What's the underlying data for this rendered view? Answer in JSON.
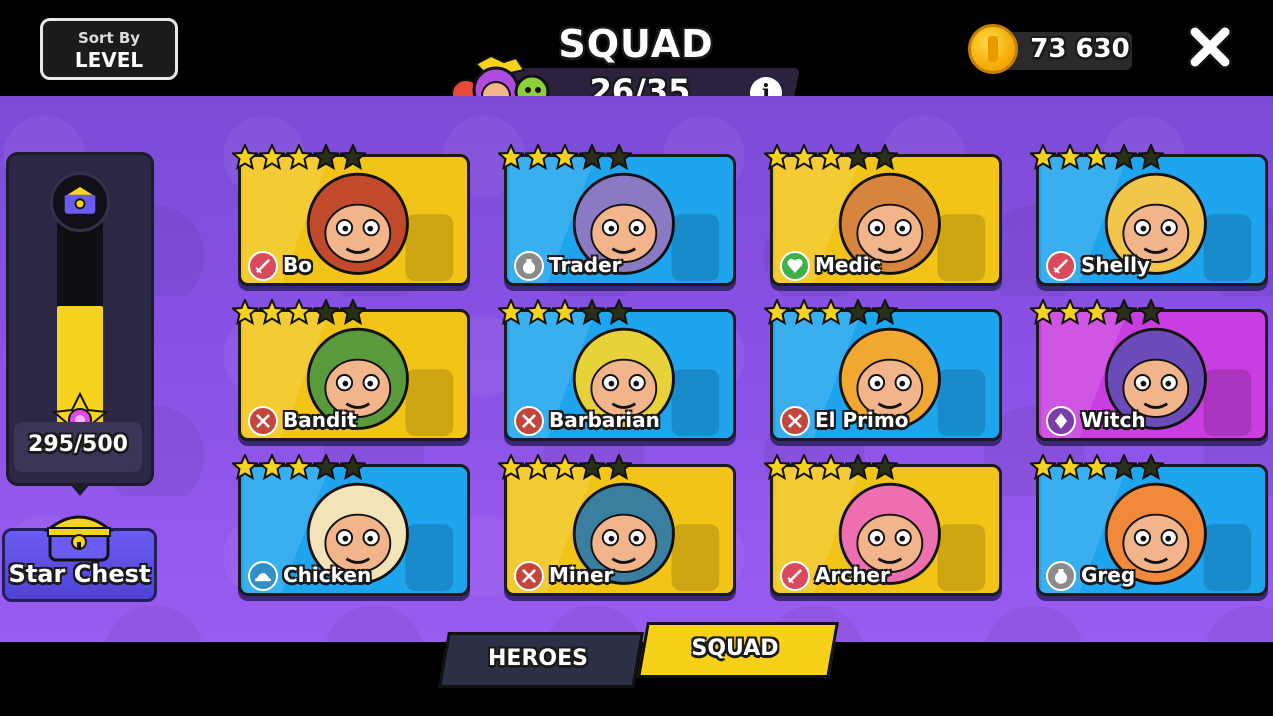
{
  "header": {
    "sort_by_label": "Sort By",
    "sort_by_value": "LEVEL",
    "title": "SQUAD",
    "squad_count": "26/35",
    "coins": "73 630"
  },
  "progress": {
    "label": "295/500",
    "current": 295,
    "max": 500,
    "fill_color": "#f6d31c"
  },
  "star_chest": {
    "label": "Star Chest"
  },
  "tabs": [
    {
      "label": "HEROES",
      "selected": false
    },
    {
      "label": "SQUAD",
      "selected": true
    }
  ],
  "heroes": [
    {
      "name": "Bo",
      "role_icon": "sword-icon",
      "stars": 3,
      "max_stars": 5,
      "bg": "#f2c418",
      "art": "#c24a2c"
    },
    {
      "name": "Trader",
      "role_icon": "moneybag-icon",
      "stars": 3,
      "max_stars": 5,
      "bg": "#1fa4ee",
      "art": "#8b79c4"
    },
    {
      "name": "Medic",
      "role_icon": "heart-icon",
      "stars": 3,
      "max_stars": 5,
      "bg": "#f2c418",
      "art": "#d7853c"
    },
    {
      "name": "Shelly",
      "role_icon": "sword-icon",
      "stars": 3,
      "max_stars": 5,
      "bg": "#1fa4ee",
      "art": "#f2c64a"
    },
    {
      "name": "Bandit",
      "role_icon": "crossed-swords-icon",
      "stars": 3,
      "max_stars": 5,
      "bg": "#f2c418",
      "art": "#5a9a3c"
    },
    {
      "name": "Barbarian",
      "role_icon": "crossed-swords-icon",
      "stars": 3,
      "max_stars": 5,
      "bg": "#1fa4ee",
      "art": "#e8d23a"
    },
    {
      "name": "El Primo",
      "role_icon": "crossed-swords-icon",
      "stars": 3,
      "max_stars": 5,
      "bg": "#1fa4ee",
      "art": "#f0a830"
    },
    {
      "name": "Witch",
      "role_icon": "crystal-icon",
      "stars": 3,
      "max_stars": 5,
      "bg": "#c93ee0",
      "art": "#6a4bb8"
    },
    {
      "name": "Chicken",
      "role_icon": "hat-icon",
      "stars": 3,
      "max_stars": 5,
      "bg": "#1fa4ee",
      "art": "#f3e3b8"
    },
    {
      "name": "Miner",
      "role_icon": "crossed-swords-icon",
      "stars": 3,
      "max_stars": 5,
      "bg": "#f2c418",
      "art": "#3a7fa0"
    },
    {
      "name": "Archer",
      "role_icon": "sword-icon",
      "stars": 3,
      "max_stars": 5,
      "bg": "#f2c418",
      "art": "#ee6fb0"
    },
    {
      "name": "Greg",
      "role_icon": "moneybag-icon",
      "stars": 3,
      "max_stars": 5,
      "bg": "#1fa4ee",
      "art": "#f08a3a"
    }
  ]
}
